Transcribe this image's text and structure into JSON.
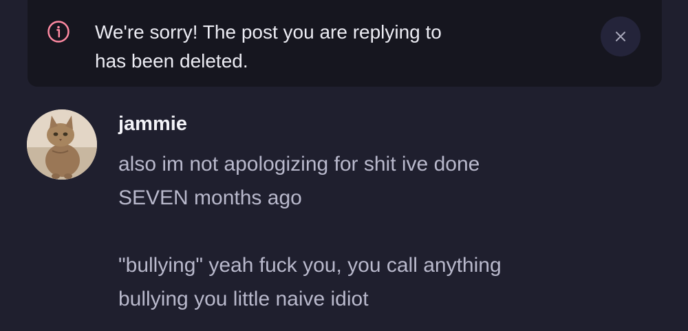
{
  "notice": {
    "icon": "info-icon",
    "text": "We're sorry! The post you are replying to\nhas been deleted.",
    "close_icon": "close-icon",
    "accent_color": "#ff8aa2"
  },
  "post": {
    "avatar": "cat-avatar",
    "username": "jammie",
    "paragraphs": [
      "also im not apologizing for shit ive done\nSEVEN months ago",
      "\"bullying\" yeah fuck you,  you call anything\nbullying you little naive idiot"
    ]
  }
}
